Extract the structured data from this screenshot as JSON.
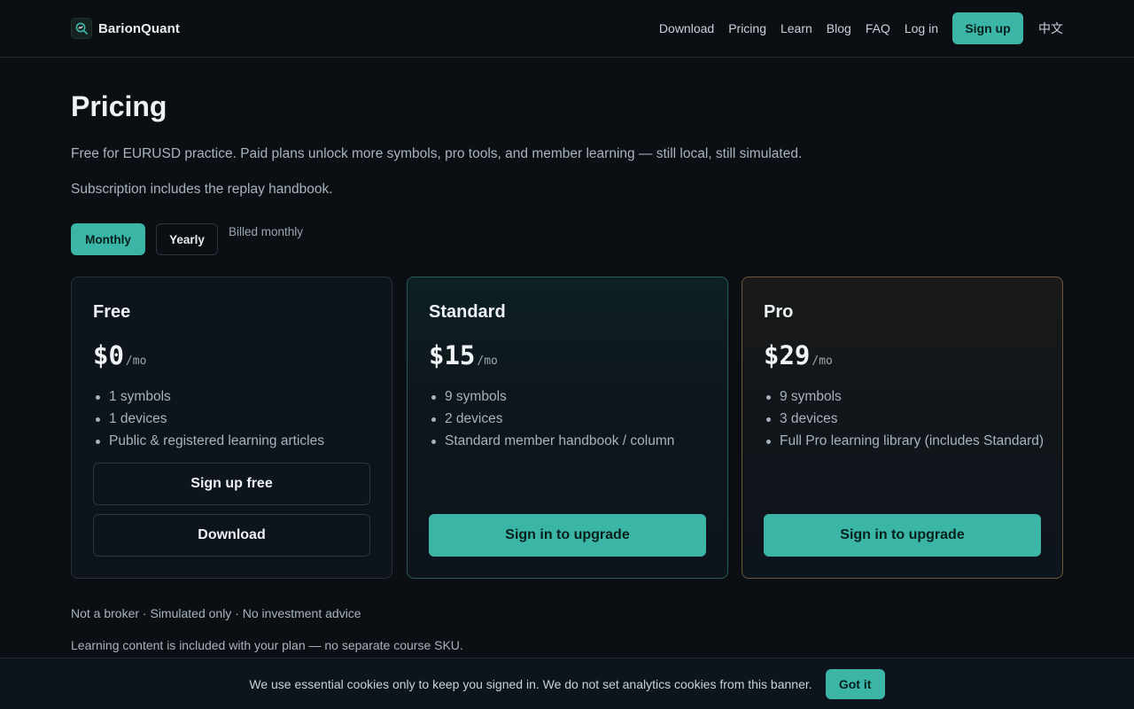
{
  "brand": {
    "name": "BarionQuant",
    "logo_icon": "search-chart-icon"
  },
  "nav": {
    "links": [
      "Download",
      "Pricing",
      "Learn",
      "Blog",
      "FAQ",
      "Log in"
    ],
    "signup_label": "Sign up",
    "language_label": "中文"
  },
  "page": {
    "title": "Pricing",
    "lead": "Free for EURUSD practice. Paid plans unlock more symbols, pro tools, and member learning — still local, still simulated.",
    "lead2": "Subscription includes the replay handbook."
  },
  "billing": {
    "monthly_label": "Monthly",
    "yearly_label": "Yearly",
    "selected": "Monthly",
    "note": "Billed monthly"
  },
  "plans": [
    {
      "name": "Free",
      "price": "$0",
      "unit": "/mo",
      "features": [
        "1 symbols",
        "1 devices",
        "Public & registered learning articles"
      ],
      "primary_label": "Sign up free",
      "secondary_label": "Download"
    },
    {
      "name": "Standard",
      "price": "$15",
      "unit": "/mo",
      "features": [
        "9 symbols",
        "2 devices",
        "Standard member handbook / column"
      ],
      "cta_label": "Sign in to upgrade"
    },
    {
      "name": "Pro",
      "price": "$29",
      "unit": "/mo",
      "features": [
        "9 symbols",
        "3 devices",
        "Full Pro learning library (includes Standard)"
      ],
      "cta_label": "Sign in to upgrade"
    }
  ],
  "footnotes": [
    "Not a broker · Simulated only · No investment advice",
    "Learning content is included with your plan — no separate course SKU."
  ],
  "cookie": {
    "text": "We use essential cookies only to keep you signed in. We do not set analytics cookies from this banner.",
    "button_label": "Got it"
  },
  "colors": {
    "accent": "#3bb5a6",
    "background": "#0b0f14",
    "standard_border": "#2a5c55",
    "pro_border": "#6b5a3e"
  }
}
